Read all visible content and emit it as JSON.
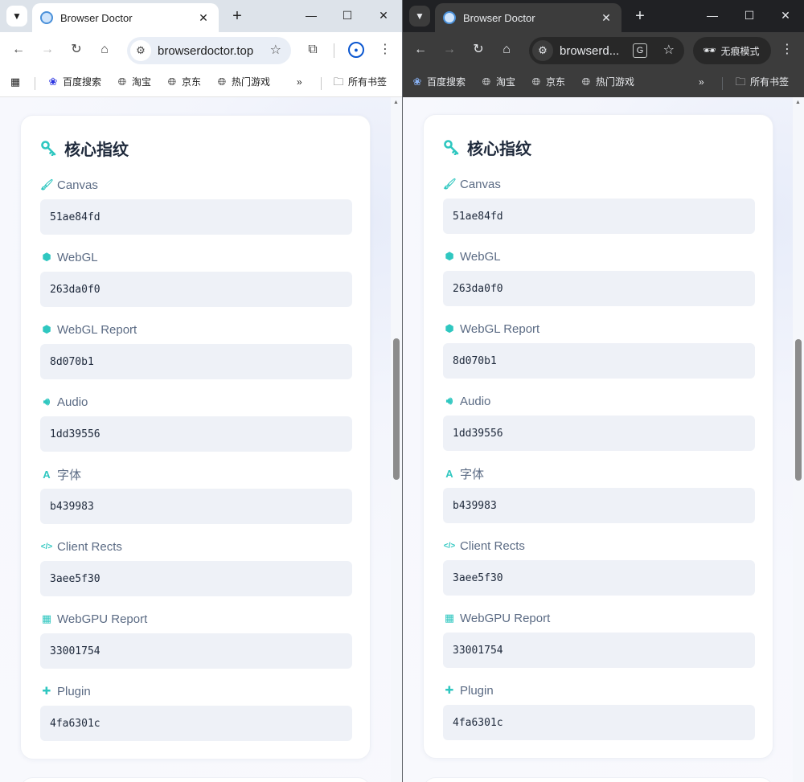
{
  "tab_title": "Browser Doctor",
  "tab_close": "✕",
  "new_tab": "+",
  "window_controls": {
    "minimize": "—",
    "maximize": "☐",
    "close": "✕"
  },
  "nav": {
    "back": "←",
    "forward": "→",
    "reload": "↻",
    "home": "⌂"
  },
  "left": {
    "url": "browserdoctor.top",
    "extensions_icon": "puzzle-icon",
    "profile_icon": "account-circle-icon"
  },
  "right": {
    "url": "browserd...",
    "incognito_label": "无痕模式",
    "translate_icon": "translate-icon"
  },
  "bookmarks": {
    "items": [
      {
        "label": "百度搜索",
        "icon": "baidu-paw-icon"
      },
      {
        "label": "淘宝",
        "icon": "globe-icon"
      },
      {
        "label": "京东",
        "icon": "globe-icon"
      },
      {
        "label": "热门游戏",
        "icon": "globe-icon"
      }
    ],
    "overflow": "»",
    "all_bookmarks": "所有书签"
  },
  "card": {
    "title": "核心指纹",
    "accent_color": "#2fc7c0",
    "fields": [
      {
        "label": "Canvas",
        "value": "51ae84fd",
        "icon": "paint-brush-icon"
      },
      {
        "label": "WebGL",
        "value": "263da0f0",
        "icon": "cube-icon"
      },
      {
        "label": "WebGL Report",
        "value": "8d070b1",
        "icon": "cube-icon"
      },
      {
        "label": "Audio",
        "value": "1dd39556",
        "icon": "speaker-icon"
      },
      {
        "label": "字体",
        "value": "b439983",
        "icon": "font-icon"
      },
      {
        "label": "Client Rects",
        "value": "3aee5f30",
        "icon": "code-icon"
      },
      {
        "label": "WebGPU Report",
        "value": "33001754",
        "icon": "chip-icon"
      },
      {
        "label": "Plugin",
        "value": "4fa6301c",
        "icon": "puzzle-piece-icon"
      }
    ]
  }
}
